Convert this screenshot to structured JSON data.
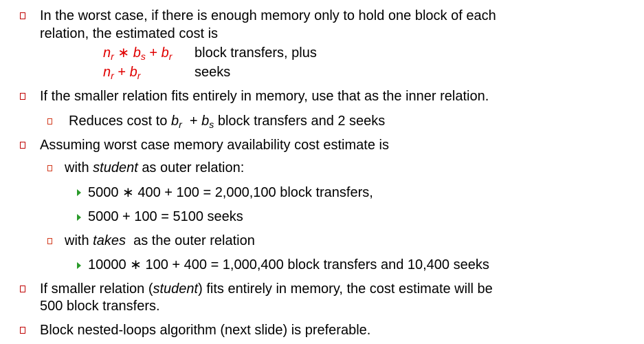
{
  "bullets": {
    "worst_case_line1": "In the worst case, if there is enough memory only to hold one block of each",
    "worst_case_line2": "relation, the estimated cost is",
    "formula1": {
      "n": "n",
      "n_sub": "r",
      "op1": "∗",
      "b1": "b",
      "b1_sub": "s",
      "op2": "+",
      "b2": "b",
      "b2_sub": "r",
      "desc": "block transfers, plus"
    },
    "formula2": {
      "n": "n",
      "n_sub": "r",
      "op": "+",
      "b": "b",
      "b_sub": "r",
      "desc": "seeks"
    },
    "smaller_fits": "If the smaller relation fits entirely in memory, use that as the inner relation.",
    "reduces": {
      "pre": "Reduces cost to",
      "b1": "b",
      "b1_sub": "r",
      "mid": "+",
      "b2": "b",
      "b2_sub": "s",
      "post": "block transfers and 2 seeks"
    },
    "assuming": "Assuming worst case memory availability cost estimate is",
    "student_outer": {
      "pre": "with",
      "name": "student",
      "post": "as outer relation:"
    },
    "student_transfers": "5000 ∗ 400 + 100 = 2,000,100 block transfers,",
    "student_seeks": "5000 + 100 = 5100 seeks",
    "takes_outer": {
      "pre": "with",
      "name": "takes",
      "post": "as the outer relation"
    },
    "takes_cost": "10000 ∗ 100 + 400 = 1,000,400 block transfers and 10,400 seeks",
    "smaller_student": {
      "pre": "If smaller relation (",
      "name": "student",
      "post": ") fits entirely in memory, the cost estimate will be"
    },
    "smaller_student_line2": "500 block transfers.",
    "block_nested": "Block nested-loops algorithm (next slide) is preferable."
  },
  "colors": {
    "bullet": "#c00000",
    "sub_bullet": "#d23b1e",
    "arrow": "#2a9a2a",
    "formula": "#e00000"
  }
}
